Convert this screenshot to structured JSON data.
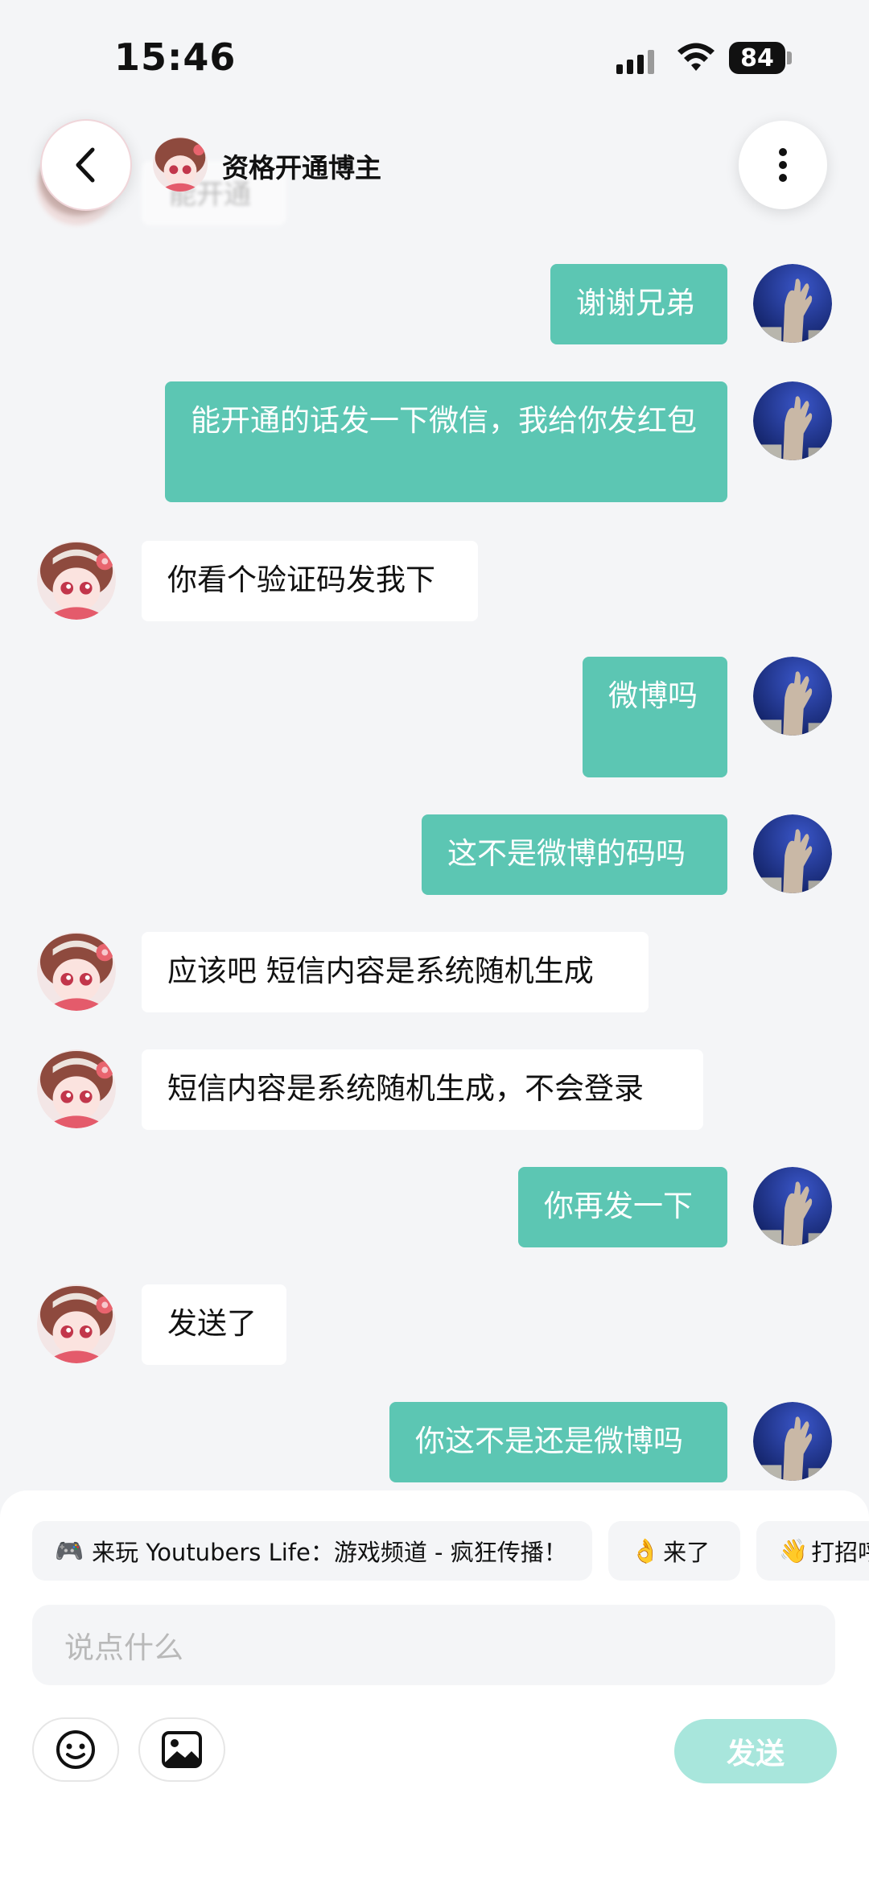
{
  "status_bar": {
    "time": "15:46",
    "battery": "84"
  },
  "header": {
    "title": "资格开通博主",
    "ghost_text": "能开通"
  },
  "messages": [
    {
      "from": "me",
      "text": "谢谢兄弟"
    },
    {
      "from": "me",
      "text": "能开通的话发一下微信，我给你发红包"
    },
    {
      "from": "other",
      "text": "你看个验证码发我下"
    },
    {
      "from": "me",
      "text": "微博吗"
    },
    {
      "from": "me",
      "text": "这不是微博的码吗"
    },
    {
      "from": "other",
      "text": "应该吧 短信内容是系统随机生成"
    },
    {
      "from": "other",
      "text": "短信内容是系统随机生成，不会登录"
    },
    {
      "from": "me",
      "text": "你再发一下"
    },
    {
      "from": "other",
      "text": "发送了"
    },
    {
      "from": "me",
      "text": "你这不是还是微博吗"
    }
  ],
  "quick_replies": [
    {
      "icon": "🎮",
      "label": "来玩 Youtubers Life：游戏频道 - 疯狂传播！"
    },
    {
      "icon": "👌",
      "label": "来了"
    },
    {
      "icon": "👋",
      "label": "打招呼"
    }
  ],
  "input": {
    "placeholder": "说点什么"
  },
  "send_label": "发送",
  "colors": {
    "my_bubble": "#5cc6b3",
    "other_bubble": "#ffffff",
    "send_button": "#a8e6dc",
    "background": "#f4f5f7"
  }
}
